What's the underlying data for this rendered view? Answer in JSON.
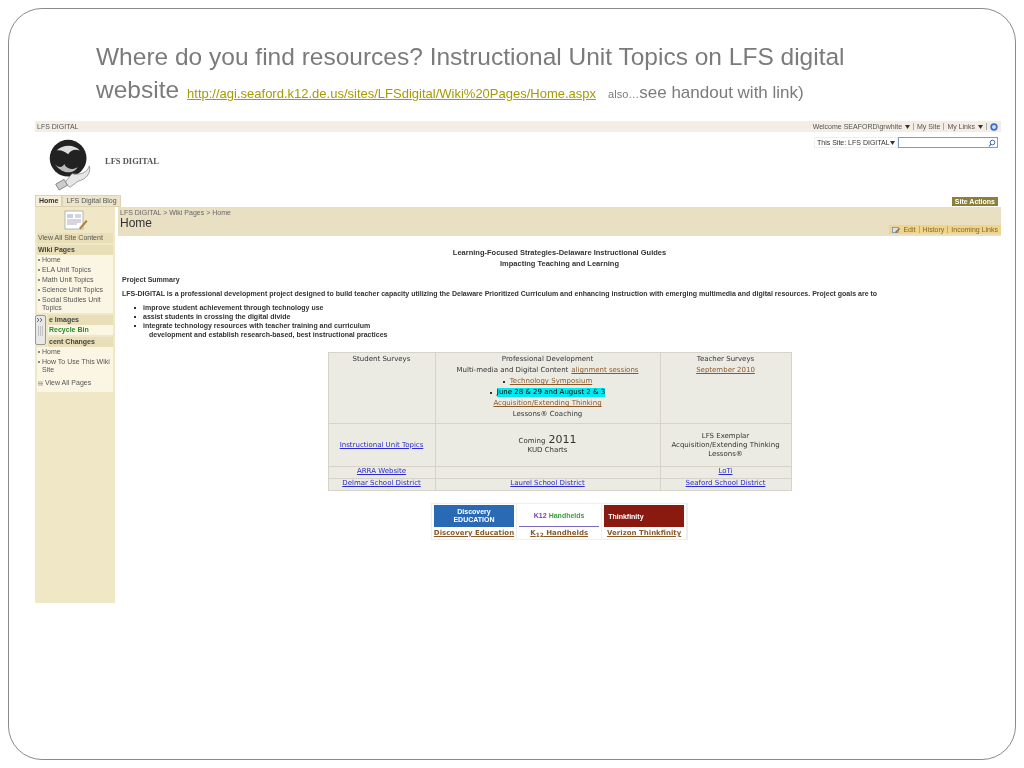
{
  "slide_title": [
    [
      {
        "kind": "text",
        "text": "Where do you find resources? Instructional Unit Topics on LFS digital"
      }
    ],
    [
      {
        "kind": "text",
        "text": "website"
      },
      {
        "kind": "link",
        "text": "http://agi.seaford.k12.de.us/sites/LFSdigital/Wiki%20Pages/Home.aspx"
      },
      {
        "kind": "small",
        "text": "also…"
      },
      {
        "kind": "medium",
        "text": "see handout with link)"
      }
    ]
  ],
  "site": {
    "top_bar": {
      "site_name": "LFS DIGITAL",
      "welcome": "Welcome SEAFORD\\grwhite",
      "links": [
        "My Site",
        "My Links"
      ]
    },
    "header": {
      "title": "LFS DIGITAL",
      "search_scope": "This Site: LFS DIGITAL"
    },
    "tabs": [
      {
        "label": "Home",
        "selected": true
      },
      {
        "label": "LFS Digital Blog",
        "selected": false
      }
    ],
    "site_actions": "Site Actions",
    "sidebar": [
      {
        "kind": "link",
        "text": "View All Site Content"
      },
      {
        "kind": "heading",
        "text": "Wiki Pages"
      },
      {
        "kind": "item",
        "text": "Home"
      },
      {
        "kind": "item",
        "text": "ELA Unit Topics"
      },
      {
        "kind": "item",
        "text": "Math Unit Topics"
      },
      {
        "kind": "item",
        "text": "Science Unit Topics"
      },
      {
        "kind": "item",
        "text": "Social Studies Unit Topics"
      },
      {
        "kind": "heading",
        "text": "e Images",
        "under_handle": true
      },
      {
        "kind": "recycle",
        "text": "Recycle Bin"
      },
      {
        "kind": "heading",
        "text": "cent Changes",
        "under_handle": true
      },
      {
        "kind": "item",
        "text": "Home"
      },
      {
        "kind": "item",
        "text": "How To Use This Wiki Site"
      },
      {
        "kind": "all",
        "text": "View All Pages"
      }
    ],
    "breadcrumb": "LFS DIGITAL > Wiki Pages > Home",
    "page_title": "Home",
    "page_toolbar": [
      "Edit",
      "History",
      "Incoming Links"
    ],
    "content": {
      "heading": [
        "Learning-Focused Strategies-Delaware Instructional Guides",
        "Impacting Teaching and Learning"
      ],
      "summary_label": "Project Summary",
      "summary": "LFS-DIGITAL is a professional development project designed to build teacher capacity utilizing the Delaware Prioritized Curriculum and enhancing instruction with emerging multimedia and digital resources. Project goals are to",
      "goals": [
        "improve student achievement through technology use",
        "assist students in crossing the digital divide",
        "integrate technology resources with teacher training and curriculum"
      ],
      "goals_continued": "development and establish research-based, best instructional practices",
      "table": {
        "rows": [
          [
            [
              {
                "segs": [
                  {
                    "kind": "text",
                    "text": "Student Surveys"
                  }
                ]
              }
            ],
            [
              {
                "segs": [
                  {
                    "kind": "text",
                    "text": "Professional Development"
                  }
                ]
              },
              {
                "segs": [
                  {
                    "kind": "text",
                    "text": "Multi-media and Digital Content"
                  },
                  {
                    "kind": "visited",
                    "text": "alignment sessions"
                  }
                ]
              },
              {
                "bullet": true,
                "segs": [
                  {
                    "kind": "visited",
                    "text": "Technology Symposium"
                  }
                ]
              },
              {
                "bullet": true,
                "segs": [
                  {
                    "kind": "highlight",
                    "text": "June 28 & 29 and August 2 & 3"
                  }
                ]
              },
              {
                "segs": [
                  {
                    "kind": "visited",
                    "text": "Acquisition/Extending Thinking"
                  }
                ]
              },
              {
                "segs": [
                  {
                    "kind": "text",
                    "text": "Lessons® Coaching"
                  }
                ]
              }
            ],
            [
              {
                "segs": [
                  {
                    "kind": "text",
                    "text": "Teacher Surveys"
                  }
                ]
              },
              {
                "segs": [
                  {
                    "kind": "visited",
                    "text": "September 2010"
                  }
                ]
              }
            ]
          ],
          [
            [
              {
                "segs": [
                  {
                    "kind": "link",
                    "text": "Instructional Unit Topics"
                  }
                ]
              }
            ],
            [
              {
                "segs": [
                  {
                    "kind": "text",
                    "text": "Coming"
                  },
                  {
                    "kind": "big",
                    "text": "2011"
                  }
                ]
              },
              {
                "segs": [
                  {
                    "kind": "text",
                    "text": "KUD Charts"
                  }
                ]
              }
            ],
            [
              {
                "segs": [
                  {
                    "kind": "text",
                    "text": "LFS Exemplar"
                  }
                ]
              },
              {
                "segs": [
                  {
                    "kind": "text",
                    "text": "Acquisition/Extending Thinking"
                  }
                ]
              },
              {
                "segs": [
                  {
                    "kind": "text",
                    "text": "Lessons®"
                  }
                ]
              }
            ]
          ],
          [
            [
              {
                "segs": [
                  {
                    "kind": "link",
                    "text": "ARRA Website"
                  }
                ]
              }
            ],
            [],
            [
              {
                "segs": [
                  {
                    "kind": "link",
                    "text": "LoTi"
                  }
                ]
              }
            ]
          ],
          [
            [
              {
                "segs": [
                  {
                    "kind": "link",
                    "text": "Delmar School District"
                  }
                ]
              }
            ],
            [
              {
                "segs": [
                  {
                    "kind": "link",
                    "text": "Laurel School District"
                  }
                ]
              }
            ],
            [
              {
                "segs": [
                  {
                    "kind": "link",
                    "text": "Seaford School District"
                  }
                ]
              }
            ]
          ]
        ]
      },
      "partners": [
        {
          "kind": "discovery",
          "logo": [
            "Discovery",
            "EDUCATION"
          ],
          "caption": "Discovery Education"
        },
        {
          "kind": "k12",
          "logo": [
            "K12",
            "Handhelds"
          ],
          "caption": "K$_{12}$ Handhelds"
        },
        {
          "kind": "thinkfinity",
          "logo": [
            "Thinkfinity"
          ],
          "caption": "Verizon Thinkfinity"
        }
      ]
    }
  }
}
